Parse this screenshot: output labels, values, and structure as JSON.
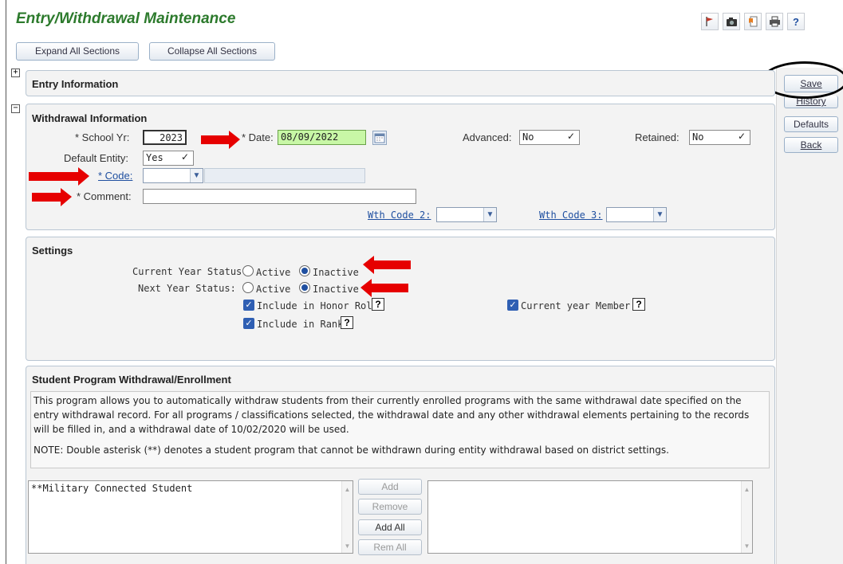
{
  "page": {
    "title": "Entry/Withdrawal Maintenance"
  },
  "toolbar": {
    "expand_label": "Expand All Sections",
    "collapse_label": "Collapse All Sections",
    "icons": [
      "flag-icon",
      "camera-icon",
      "bookmark-icon",
      "print-icon",
      "help-icon"
    ],
    "help_glyph": "?"
  },
  "side_actions": {
    "save": "Save",
    "history": "History",
    "defaults": "Defaults",
    "back": "Back"
  },
  "entry_section": {
    "title": "Entry Information",
    "toggle": "+"
  },
  "withdrawal_section": {
    "title": "Withdrawal Information",
    "toggle": "−",
    "school_yr_label": "* School Yr:",
    "school_yr_value": "2023",
    "date_label": "* Date:",
    "date_value": "08/09/2022",
    "advanced_label": "Advanced:",
    "advanced_value": "No",
    "retained_label": "Retained:",
    "retained_value": "No",
    "default_entity_label": "Default Entity:",
    "default_entity_value": "Yes",
    "code_label": "* Code:",
    "code_value": "",
    "comment_label": "* Comment:",
    "comment_value": "",
    "wth_code2_label": "Wth Code 2:",
    "wth_code3_label": "Wth Code 3:"
  },
  "settings_section": {
    "title": "Settings",
    "current_year_status_label": "Current Year Status:",
    "next_year_status_label": "Next Year Status:",
    "active_label": "Active",
    "inactive_label": "Inactive",
    "current_year_status": "Inactive",
    "next_year_status": "Inactive",
    "honor_roll_label": "Include in Honor Roll",
    "rank_label": "Include in Rank",
    "current_member_label": "Current year Member",
    "help_glyph": "?"
  },
  "program_section": {
    "title": "Student Program Withdrawal/Enrollment",
    "description": "This program allows you to automatically withdraw students from their currently enrolled programs with the same withdrawal date specified on the entry withdrawal record. For all programs / classifications selected, the withdrawal date and any other withdrawal elements pertaining to the records will be filled in, and a withdrawal date of 10/02/2020 will be used.",
    "note": "NOTE: Double asterisk (**) denotes a student program that cannot be withdrawn during entity withdrawal based on district settings.",
    "available_items": [
      "**Military Connected Student"
    ],
    "buttons": {
      "add": "Add",
      "remove": "Remove",
      "add_all": "Add All",
      "rem_all": "Rem All"
    }
  },
  "colors": {
    "title_green": "#2c7a2c",
    "arrow_red": "#e60000",
    "date_highlight": "#c8f7a6",
    "link_blue": "#1f4fa0"
  }
}
